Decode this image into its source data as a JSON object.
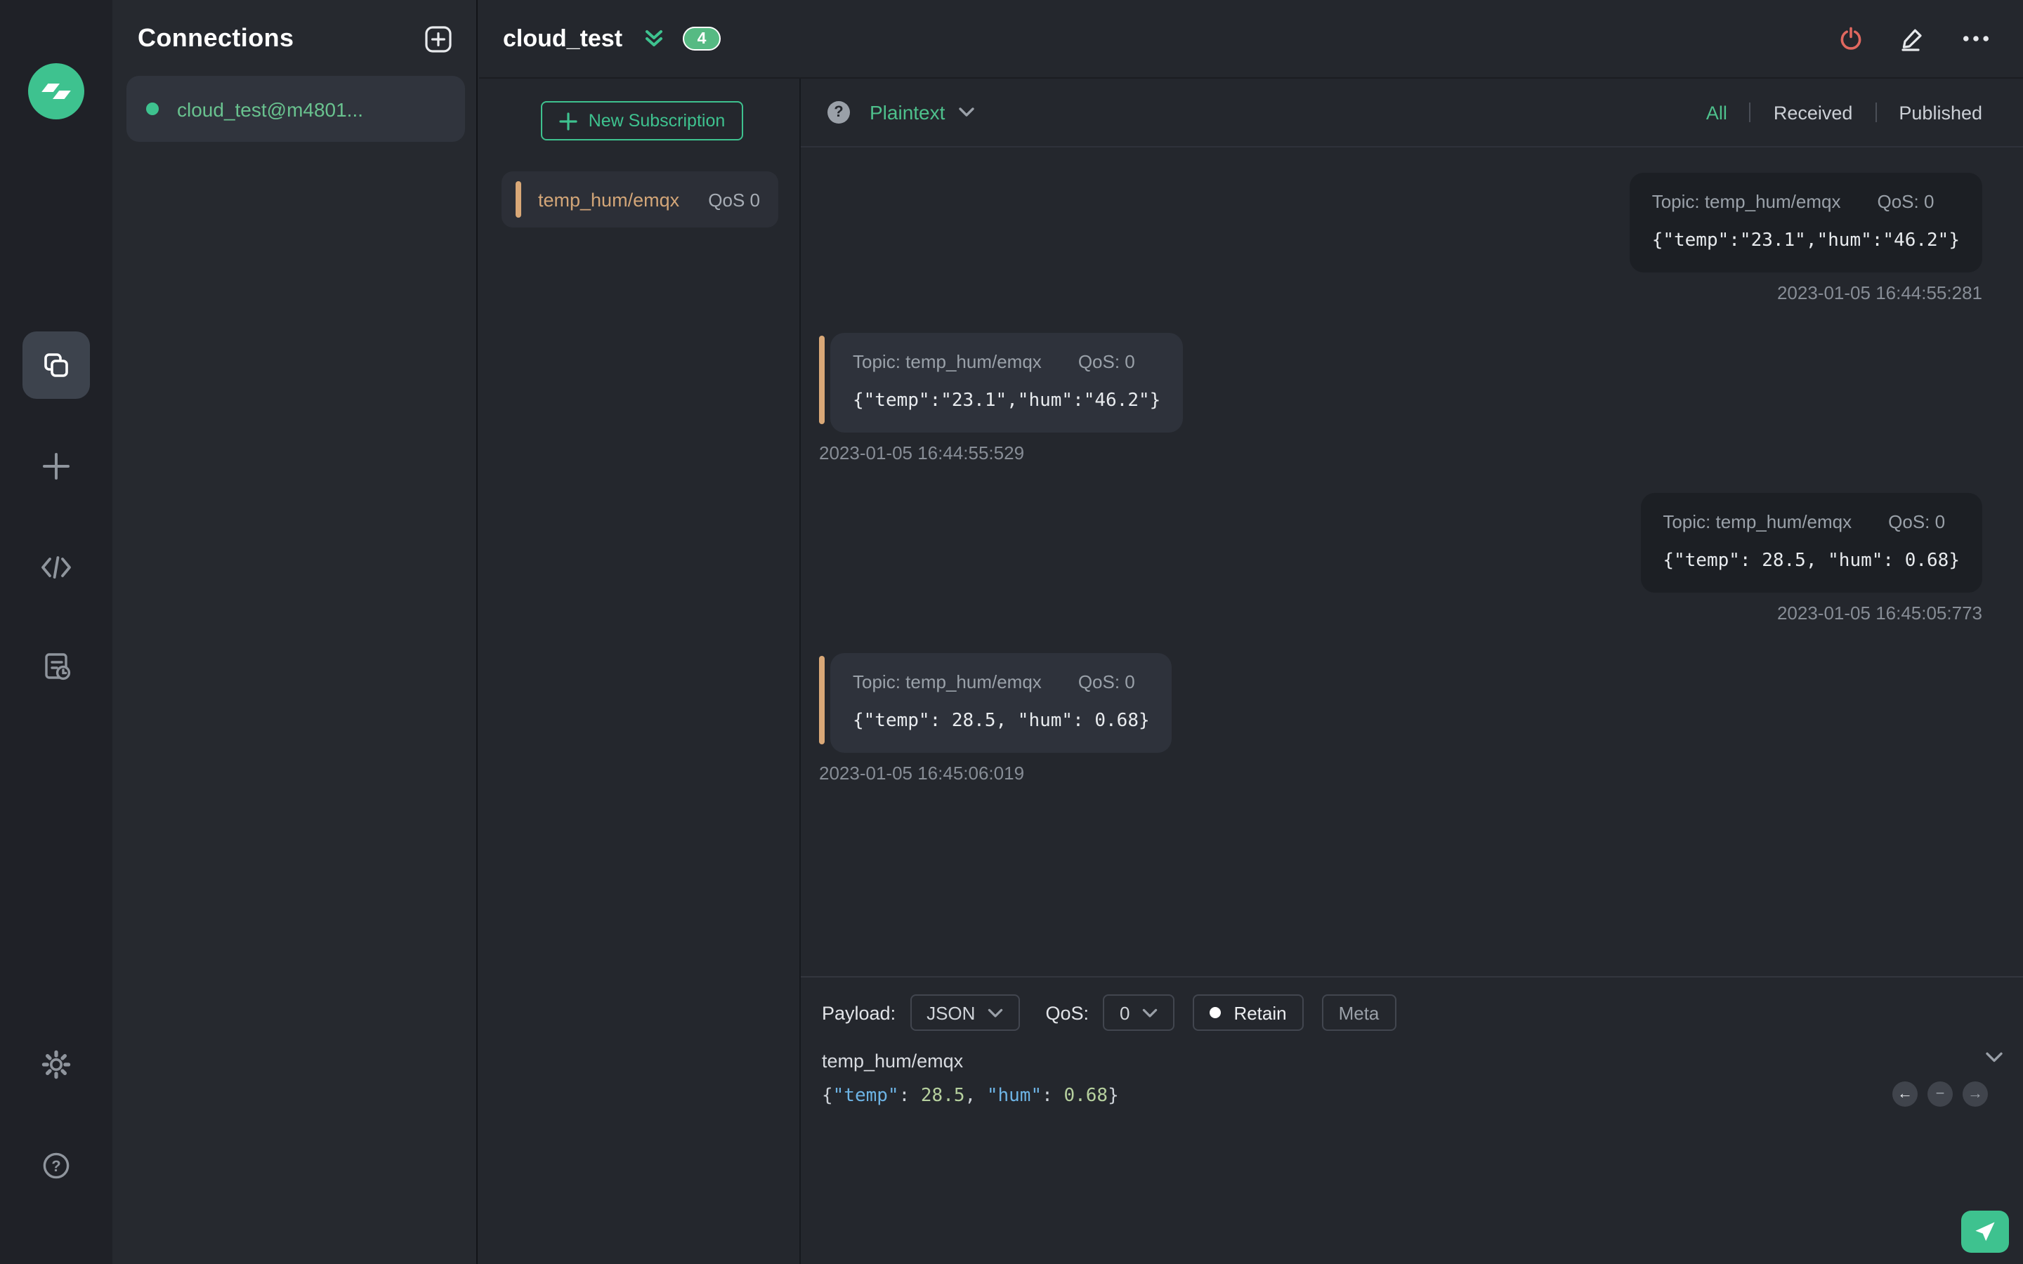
{
  "colors": {
    "accent": "#3ec28f",
    "topic_orange": "#d9a877",
    "danger": "#e0685f"
  },
  "sidebar": {
    "icons": [
      "connections",
      "new-connection",
      "script",
      "log",
      "settings",
      "help"
    ]
  },
  "connections": {
    "title": "Connections",
    "items": [
      {
        "name": "cloud_test@m4801...",
        "status": "connected"
      }
    ]
  },
  "header": {
    "title": "cloud_test",
    "unread_badge": "4"
  },
  "subscriptions": {
    "new_label": "New Subscription",
    "items": [
      {
        "topic": "temp_hum/emqx",
        "qos": "QoS 0"
      }
    ]
  },
  "toolbar": {
    "help": "?",
    "format": "Plaintext",
    "filters": [
      "All",
      "Received",
      "Published"
    ],
    "active_filter": "All"
  },
  "messages": [
    {
      "type": "publish",
      "topic_label": "Topic: temp_hum/emqx",
      "qos_label": "QoS: 0",
      "payload": "{\"temp\":\"23.1\",\"hum\":\"46.2\"}",
      "timestamp": "2023-01-05 16:44:55:281"
    },
    {
      "type": "receive",
      "topic_label": "Topic: temp_hum/emqx",
      "qos_label": "QoS: 0",
      "payload": "{\"temp\":\"23.1\",\"hum\":\"46.2\"}",
      "timestamp": "2023-01-05 16:44:55:529"
    },
    {
      "type": "publish",
      "topic_label": "Topic: temp_hum/emqx",
      "qos_label": "QoS: 0",
      "payload": "{\"temp\": 28.5, \"hum\": 0.68}",
      "timestamp": "2023-01-05 16:45:05:773"
    },
    {
      "type": "receive",
      "topic_label": "Topic: temp_hum/emqx",
      "qos_label": "QoS: 0",
      "payload": "{\"temp\": 28.5, \"hum\": 0.68}",
      "timestamp": "2023-01-05 16:45:06:019"
    }
  ],
  "publish": {
    "payload_label": "Payload:",
    "format": "JSON",
    "qos_label": "QoS:",
    "qos": "0",
    "retain_label": "Retain",
    "meta_label": "Meta",
    "topic": "temp_hum/emqx",
    "payload_tokens": [
      {
        "text": "{",
        "type": "punct"
      },
      {
        "text": "\"temp\"",
        "type": "key"
      },
      {
        "text": ": ",
        "type": "punct"
      },
      {
        "text": "28.5",
        "type": "num"
      },
      {
        "text": ", ",
        "type": "punct"
      },
      {
        "text": "\"hum\"",
        "type": "key"
      },
      {
        "text": ": ",
        "type": "punct"
      },
      {
        "text": "0.68",
        "type": "num"
      },
      {
        "text": "}",
        "type": "punct"
      }
    ]
  }
}
